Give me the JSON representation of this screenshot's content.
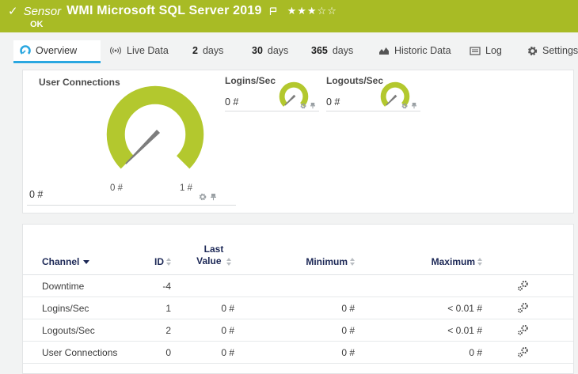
{
  "header": {
    "check": "✓",
    "type_label": "Sensor",
    "title": "WMI Microsoft SQL Server 2019",
    "status": "OK",
    "stars": "★★★☆☆"
  },
  "tabs": {
    "overview": "Overview",
    "live_data": "Live Data",
    "d2_num": "2",
    "d2_unit": "days",
    "d30_num": "30",
    "d30_unit": "days",
    "d365_num": "365",
    "d365_unit": "days",
    "historic": "Historic Data",
    "log": "Log",
    "settings": "Settings"
  },
  "gauges": {
    "main": {
      "title": "User Connections",
      "value": "0 #",
      "scale_min": "0 #",
      "scale_max": "1 #"
    },
    "logins": {
      "title": "Logins/Sec",
      "value": "0 #"
    },
    "logouts": {
      "title": "Logouts/Sec",
      "value": "0 #"
    }
  },
  "table": {
    "headers": {
      "channel": "Channel",
      "id": "ID",
      "last_value": "Last Value",
      "minimum": "Minimum",
      "maximum": "Maximum"
    },
    "rows": [
      {
        "channel": "Downtime",
        "id": "-4",
        "last": "",
        "min": "",
        "max": ""
      },
      {
        "channel": "Logins/Sec",
        "id": "1",
        "last": "0 #",
        "min": "0 #",
        "max": "< 0.01 #"
      },
      {
        "channel": "Logouts/Sec",
        "id": "2",
        "last": "0 #",
        "min": "0 #",
        "max": "< 0.01 #"
      },
      {
        "channel": "User Connections",
        "id": "0",
        "last": "0 #",
        "min": "0 #",
        "max": "0 #"
      }
    ]
  },
  "colors": {
    "status_green": "#a8bb25",
    "gauge_green": "#b3c82e",
    "needle_gray": "#7d7d7d",
    "accent_blue": "#2aa7e0",
    "table_header_navy": "#1c2856"
  }
}
